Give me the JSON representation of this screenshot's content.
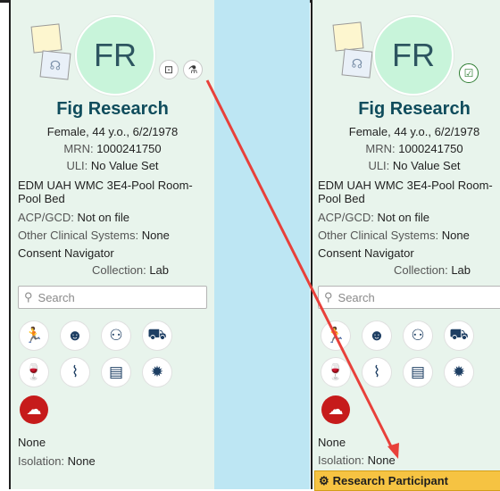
{
  "left": {
    "initials": "FR",
    "name": "Fig Research",
    "demo": "Female, 44 y.o., 6/2/1978",
    "mrn_label": "MRN:",
    "mrn": "1000241750",
    "uli_label": "ULI:",
    "uli": "No Value Set",
    "location_1": "EDM UAH WMC 3E4-Pool Room-",
    "location_2": "Pool Bed",
    "acp_label": "ACP/GCD:",
    "acp": "Not on file",
    "other_label": "Other Clinical Systems:",
    "other": "None",
    "consent": "Consent Navigator",
    "collection_label": "Collection:",
    "collection": "Lab",
    "search_placeholder": "Search",
    "none": "None",
    "isolation_label": "Isolation:",
    "isolation": "None"
  },
  "right": {
    "initials": "FR",
    "name": "Fig Research",
    "demo": "Female, 44 y.o., 6/2/1978",
    "mrn_label": "MRN:",
    "mrn": "1000241750",
    "uli_label": "ULI:",
    "uli": "No Value Set",
    "location_1": "EDM UAH WMC 3E4-Pool Room-",
    "location_2": "Pool Bed",
    "acp_label": "ACP/GCD:",
    "acp": "Not on file",
    "other_label": "Other Clinical Systems:",
    "other": "None",
    "consent": "Consent Navigator",
    "collection_label": "Collection:",
    "collection": "Lab",
    "search_placeholder": "Search",
    "none": "None",
    "isolation_label": "Isolation:",
    "isolation": "None",
    "banner": "Research Participant"
  },
  "icons": [
    "running-icon",
    "head-icon",
    "family-icon",
    "car-icon",
    "drink-icon",
    "smoking-icon",
    "money-icon",
    "virus-icon",
    "alert-icon"
  ],
  "colors": {
    "panel_bg": "#e8f4ec",
    "divider_bg": "#bde6f3",
    "name": "#0f4c5c",
    "arrow": "#e8403a",
    "banner": "#f6c342",
    "alert": "#c61b1b"
  }
}
